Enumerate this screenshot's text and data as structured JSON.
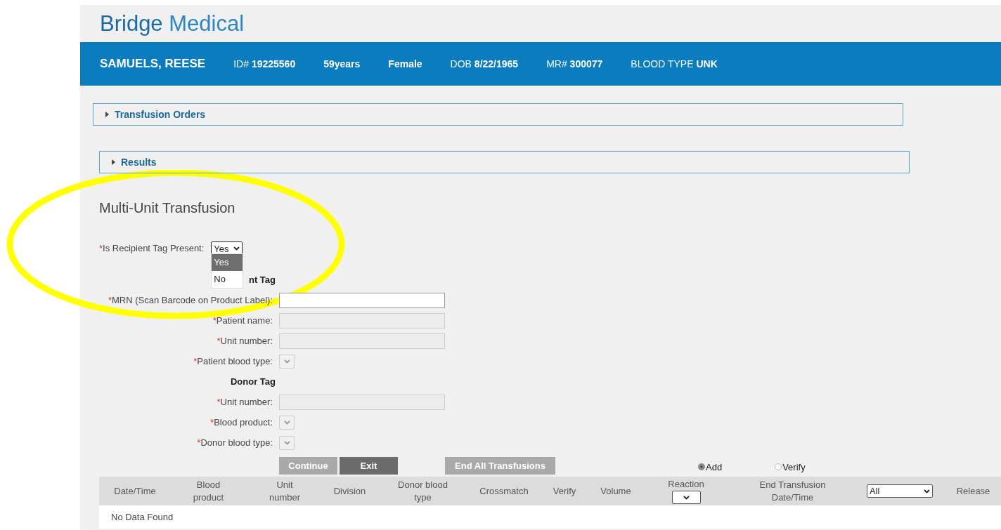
{
  "app": {
    "title_first": "Bridge",
    "title_second": "Medical"
  },
  "patient": {
    "name": "SAMUELS, REESE",
    "fields": [
      {
        "label": "ID#",
        "value": "19225560"
      },
      {
        "value": "59years"
      },
      {
        "value": "Female"
      },
      {
        "label": "DOB",
        "value": "8/22/1965"
      },
      {
        "label": "MR#",
        "value": "300077"
      },
      {
        "label": "BLOOD TYPE",
        "value": "UNK"
      }
    ]
  },
  "sections": [
    {
      "label": "Transfusion Orders",
      "expanded": false
    },
    {
      "label": "Results",
      "expanded": false
    }
  ],
  "form": {
    "title": "Multi-Unit Transfusion",
    "rows": [
      {
        "kind": "question",
        "mark": "*",
        "label": "Is Recipient Tag Present:",
        "value": "Yes",
        "open": true,
        "options": [
          {
            "label": "Yes",
            "selected": true
          },
          {
            "label": "No",
            "selected": false
          }
        ]
      },
      {
        "kind": "heading",
        "label_parts": [
          "nt Tag"
        ]
      },
      {
        "kind": "input",
        "mark": "*",
        "label": "MRN (Scan Barcode on Product Label):",
        "disabled": false
      },
      {
        "kind": "input",
        "mark": "*",
        "label": "Patient name:",
        "disabled": true
      },
      {
        "kind": "input",
        "mark": "*",
        "label": "Unit number:",
        "disabled": true
      },
      {
        "kind": "select",
        "mark": "*",
        "label": "Patient blood type:",
        "disabled": true
      },
      {
        "kind": "heading",
        "label_parts": [
          "Donor Tag"
        ]
      },
      {
        "kind": "input",
        "mark": "*",
        "label": "Unit number:",
        "disabled": true
      },
      {
        "kind": "select",
        "mark": "*",
        "label": "Blood product:",
        "disabled": true
      },
      {
        "kind": "select",
        "mark": "*",
        "label": "Donor blood type:",
        "disabled": true
      }
    ],
    "buttons": [
      {
        "label": "Continue",
        "disabled": true
      },
      {
        "label": "Exit",
        "disabled": false
      },
      {
        "label": "End All Transfusions",
        "disabled": true
      }
    ],
    "modes": [
      {
        "label": "Add",
        "selected": true
      },
      {
        "label": "Verify",
        "selected": false
      }
    ]
  },
  "table": {
    "columns": [
      {
        "kind": "text",
        "label": "Date/Time"
      },
      {
        "kind": "text",
        "label": "Blood product"
      },
      {
        "kind": "text",
        "label": "Unit number"
      },
      {
        "kind": "text",
        "label": "Division"
      },
      {
        "kind": "text",
        "label": "Donor blood type"
      },
      {
        "kind": "text",
        "label": "Crossmatch"
      },
      {
        "kind": "text",
        "label": "Verify"
      },
      {
        "kind": "text",
        "label": "Volume"
      },
      {
        "kind": "filter",
        "label": "Reaction"
      },
      {
        "kind": "text",
        "label": "End Transfusion Date/Time"
      },
      {
        "kind": "filter",
        "value": "All"
      },
      {
        "kind": "text",
        "label": "Release"
      }
    ],
    "empty_message": "No Data Found"
  }
}
